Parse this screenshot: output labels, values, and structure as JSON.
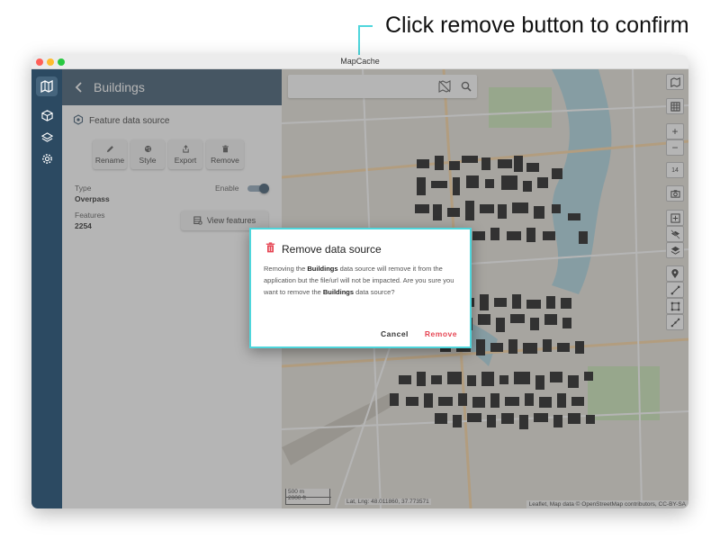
{
  "annotation": {
    "caption": "Click remove button to confirm"
  },
  "window": {
    "title": "MapCache"
  },
  "panel": {
    "title": "Buildings",
    "source_label": "Feature data source",
    "actions": [
      {
        "label": "Rename",
        "icon": "pencil-icon"
      },
      {
        "label": "Style",
        "icon": "palette-icon"
      },
      {
        "label": "Export",
        "icon": "export-icon"
      },
      {
        "label": "Remove",
        "icon": "trash-icon"
      }
    ],
    "type_label": "Type",
    "type_value": "Overpass",
    "enable_label": "Enable",
    "enabled": true,
    "features_label": "Features",
    "features_value": "2254",
    "view_features_label": "View features"
  },
  "map": {
    "zoom_level": "14",
    "scale_metric": "500 m",
    "scale_imperial": "2000 ft",
    "latlng": "Lat, Lng: 48.011860, 37.773571",
    "attribution": "Leaflet, Map data © OpenStreetMap contributors, CC-BY-SA"
  },
  "dialog": {
    "title": "Remove data source",
    "body_1": "Removing the ",
    "body_bold_1": "Buildings",
    "body_2": " data source will remove it from the application but the file/url will not be impacted. Are you sure you want to remove the ",
    "body_bold_2": "Buildings",
    "body_3": " data source?",
    "cancel_label": "Cancel",
    "remove_label": "Remove"
  },
  "colors": {
    "accent": "#36536b",
    "rail": "#2c4a62",
    "highlight": "#4fd6dc",
    "danger": "#e64553"
  }
}
